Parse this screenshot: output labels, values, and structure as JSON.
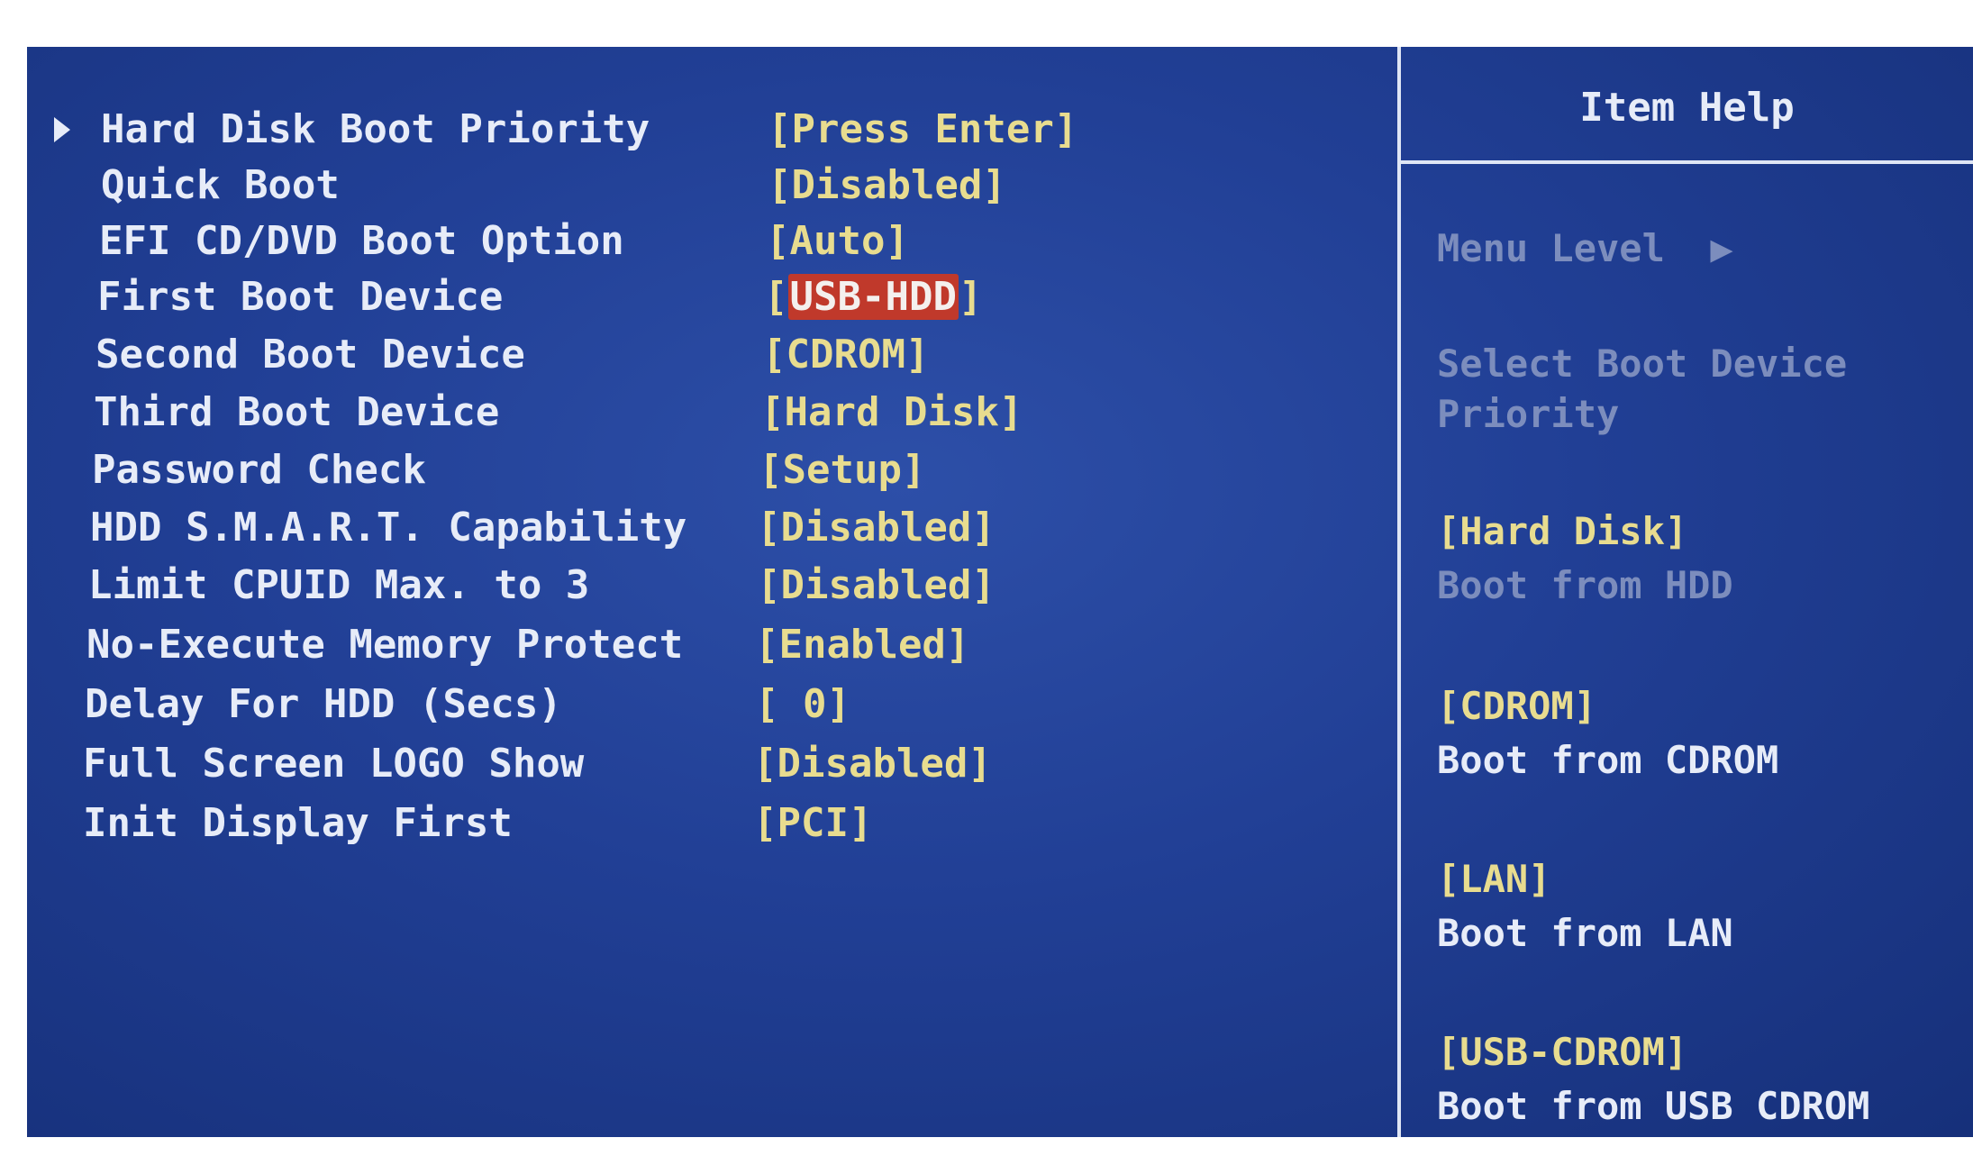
{
  "settings": [
    {
      "label": "Hard Disk Boot Priority",
      "value": "[Press Enter]"
    },
    {
      "label": "Quick Boot",
      "value": "[Disabled]"
    },
    {
      "label": "EFI CD/DVD Boot Option",
      "value": "[Auto]"
    },
    {
      "label": "First Boot Device",
      "value_open": "[",
      "value_selected": "USB-HDD",
      "value_close": "]"
    },
    {
      "label": "Second Boot Device",
      "value": "[CDROM]"
    },
    {
      "label": "Third Boot Device",
      "value": "[Hard Disk]"
    },
    {
      "label": "Password Check",
      "value": "[Setup]"
    },
    {
      "label": "HDD S.M.A.R.T. Capability",
      "value": "[Disabled]"
    },
    {
      "label": "Limit CPUID Max. to 3",
      "value": "[Disabled]"
    },
    {
      "label": "No-Execute Memory Protect",
      "value": "[Enabled]"
    },
    {
      "label": "Delay For HDD (Secs)",
      "value": "[ 0]"
    },
    {
      "label": "Full Screen LOGO Show",
      "value": "[Disabled]"
    },
    {
      "label": "Init Display First",
      "value": "[PCI]"
    }
  ],
  "help": {
    "title": "Item Help",
    "menu_level": "Menu Level  ▶",
    "description_1": "Select Boot Device",
    "description_2": "Priority",
    "options": [
      {
        "name": "[Hard Disk]",
        "desc": "Boot from HDD"
      },
      {
        "name": "[CDROM]",
        "desc": "Boot from CDROM"
      },
      {
        "name": "[LAN]",
        "desc": "Boot from LAN"
      },
      {
        "name": "[USB-CDROM]",
        "desc": "Boot from USB CDROM"
      }
    ]
  },
  "colors": {
    "background": "#213f95",
    "label": "#e7ecf8",
    "value": "#e8dc8f",
    "selection": "#c0392b",
    "dim_text": "#7c8dbd"
  }
}
